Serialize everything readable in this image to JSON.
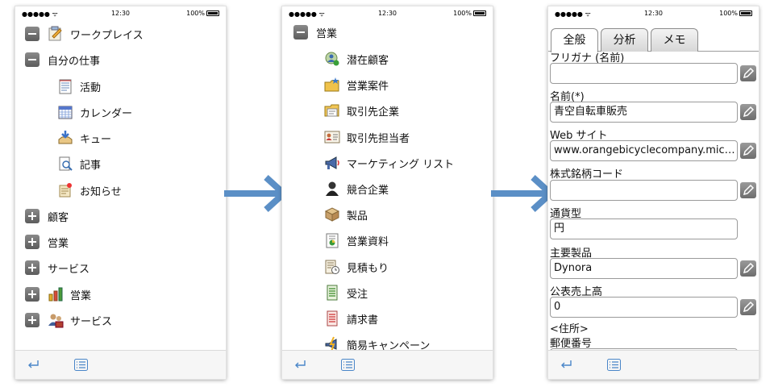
{
  "status_bar": {
    "signal": "●●●●● ᯤ",
    "time": "12:30",
    "battery": "100%"
  },
  "screen1": {
    "items": [
      {
        "label": "ワークプレイス",
        "toggle": "minus",
        "icon": "workplace-icon"
      },
      {
        "label": "自分の仕事",
        "toggle": "minus"
      },
      {
        "label": "活動",
        "icon": "activity-icon"
      },
      {
        "label": "カレンダー",
        "icon": "calendar-icon"
      },
      {
        "label": "キュー",
        "icon": "queue-icon"
      },
      {
        "label": "記事",
        "icon": "article-icon"
      },
      {
        "label": "お知らせ",
        "icon": "announcement-icon"
      },
      {
        "label": "顧客",
        "toggle": "plus"
      },
      {
        "label": "営業",
        "toggle": "plus"
      },
      {
        "label": "サービス",
        "toggle": "plus"
      },
      {
        "label": "営業",
        "toggle": "plus",
        "icon": "sales-chart-icon"
      },
      {
        "label": "サービス",
        "toggle": "plus",
        "icon": "service-people-icon"
      }
    ]
  },
  "screen2": {
    "header": "営業",
    "items": [
      {
        "label": "潜在顧客",
        "icon": "lead-icon"
      },
      {
        "label": "営業案件",
        "icon": "opportunity-icon"
      },
      {
        "label": "取引先企業",
        "icon": "account-icon"
      },
      {
        "label": "取引先担当者",
        "icon": "contact-icon"
      },
      {
        "label": "マーケティング リスト",
        "icon": "marketing-list-icon"
      },
      {
        "label": "競合企業",
        "icon": "competitor-icon"
      },
      {
        "label": "製品",
        "icon": "product-icon"
      },
      {
        "label": "営業資料",
        "icon": "sales-literature-icon"
      },
      {
        "label": "見積もり",
        "icon": "quote-icon"
      },
      {
        "label": "受注",
        "icon": "order-icon"
      },
      {
        "label": "請求書",
        "icon": "invoice-icon"
      },
      {
        "label": "簡易キャンペーン",
        "icon": "quick-campaign-icon"
      }
    ]
  },
  "screen3": {
    "tabs": [
      "全般",
      "分析",
      "メモ"
    ],
    "fields": [
      {
        "label": "フリガナ (名前)",
        "value": "",
        "editable": true
      },
      {
        "label": "名前(*)",
        "value": "青空自転車販売",
        "editable": true
      },
      {
        "label": "Web サイト",
        "value": "www.orangebicyclecompany.micr...",
        "editable": true
      },
      {
        "label": "株式銘柄コード",
        "value": "",
        "editable": true
      },
      {
        "label": "通貨型",
        "value": "円",
        "editable": false
      },
      {
        "label": "主要製品",
        "value": "Dynora",
        "editable": true
      },
      {
        "label": "公表売上高",
        "value": "0",
        "editable": true
      }
    ],
    "section": "<住所>",
    "last_label": "郵便番号"
  },
  "colors": {
    "arrow": "#5b8fc6",
    "toggle": "#6e6e6e",
    "toolbar_icon": "#4a86c8"
  }
}
